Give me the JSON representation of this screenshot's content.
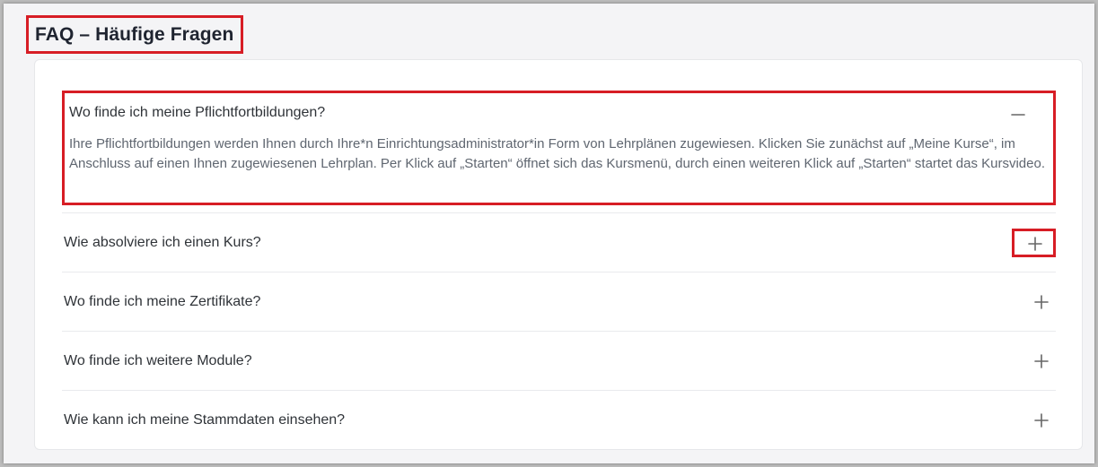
{
  "page": {
    "title": "FAQ – Häufige Fragen"
  },
  "faq": {
    "items": [
      {
        "question": "Wo finde ich meine Pflichtfortbildungen?",
        "answer": "Ihre Pflichtfortbildungen werden Ihnen durch Ihre*n Einrichtungsadministrator*in Form von Lehrplänen zugewiesen. Klicken Sie zunächst auf „Meine Kurse“, im Anschluss auf einen Ihnen zugewiesenen Lehrplan. Per Klick auf „Starten“ öffnet sich das Kursmenü, durch einen weiteren Klick auf „Starten“ startet das Kursvideo.",
        "expanded": true,
        "toggle_icon": "minus-icon"
      },
      {
        "question": "Wie absolviere ich einen Kurs?",
        "expanded": false,
        "toggle_icon": "plus-icon"
      },
      {
        "question": "Wo finde ich meine Zertifikate?",
        "expanded": false,
        "toggle_icon": "plus-icon"
      },
      {
        "question": "Wo finde ich weitere Module?",
        "expanded": false,
        "toggle_icon": "plus-icon"
      },
      {
        "question": "Wie kann ich meine Stammdaten einsehen?",
        "expanded": false,
        "toggle_icon": "plus-icon"
      }
    ]
  },
  "colors": {
    "highlight": "#d71d25",
    "background": "#f4f4f6",
    "card": "#ffffff",
    "text": "#2f3338",
    "muted_text": "#5f6670"
  }
}
